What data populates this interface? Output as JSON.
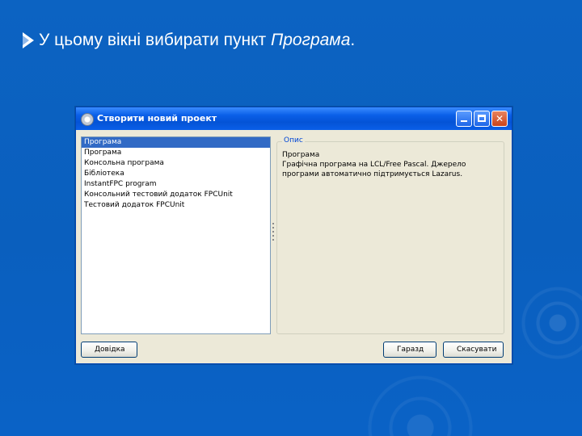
{
  "slide": {
    "title_prefix": "У цьому вікні вибирати пункт ",
    "title_item": "Програма",
    "title_suffix": "."
  },
  "window": {
    "title": "Створити новий проект",
    "list": {
      "items": [
        "Програма",
        "Програма",
        "Консольна програма",
        "Бібліотека",
        "InstantFPC program",
        "Консольний тестовий додаток FPCUnit",
        "Тестовий додаток FPCUnit"
      ],
      "selected_index": 0
    },
    "description": {
      "legend": "Опис",
      "line1": "Програма",
      "line2": "Графічна програма на LCL/Free Pascal. Джерело",
      "line3": "програми автоматично підтримується Lazarus."
    },
    "buttons": {
      "help": "Довідка",
      "ok": "Гаразд",
      "cancel": "Скасувати"
    }
  },
  "colors": {
    "background": "#0a5fbe",
    "titlebar": "#0a5fe8",
    "selection": "#316ac5",
    "legend_text": "#0046d5"
  },
  "icons": [
    "bullet-arrow-icon",
    "app-gear-icon",
    "minimize-icon",
    "maximize-icon",
    "close-icon"
  ]
}
